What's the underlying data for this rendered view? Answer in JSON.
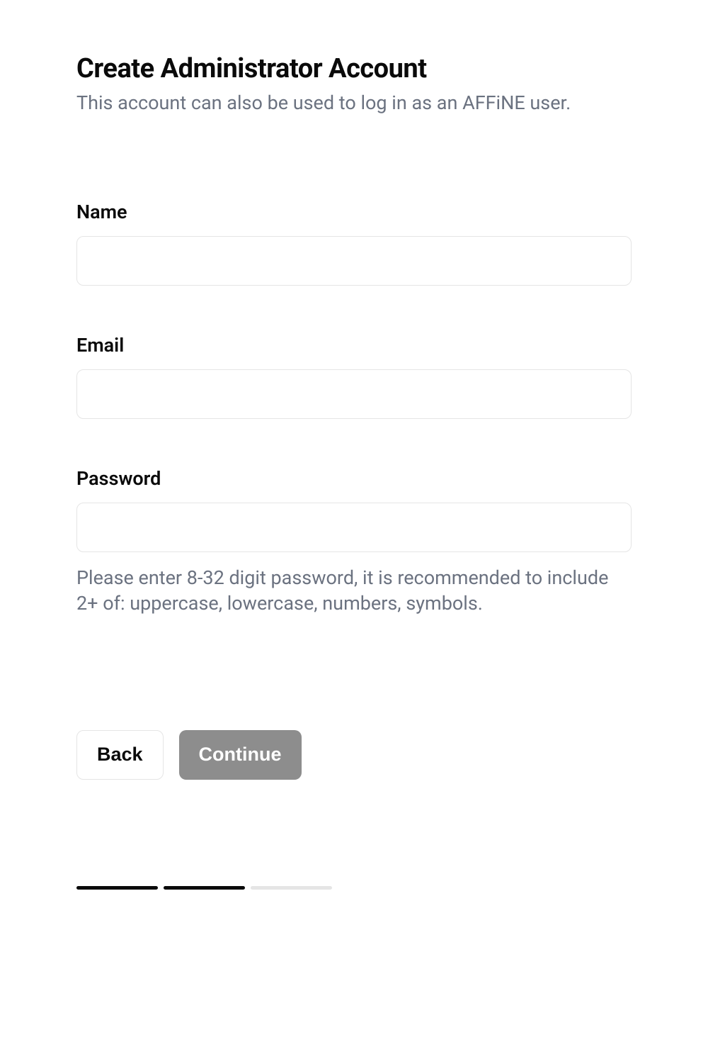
{
  "header": {
    "title": "Create Administrator Account",
    "subtitle": "This account can also be used to log in as an AFFiNE user."
  },
  "form": {
    "name": {
      "label": "Name",
      "value": ""
    },
    "email": {
      "label": "Email",
      "value": ""
    },
    "password": {
      "label": "Password",
      "value": "",
      "hint": "Please enter 8-32 digit password, it is recommended to include 2+ of: uppercase, lowercase, numbers, symbols."
    }
  },
  "buttons": {
    "back": "Back",
    "continue": "Continue"
  },
  "progress": {
    "total": 3,
    "current": 2
  }
}
